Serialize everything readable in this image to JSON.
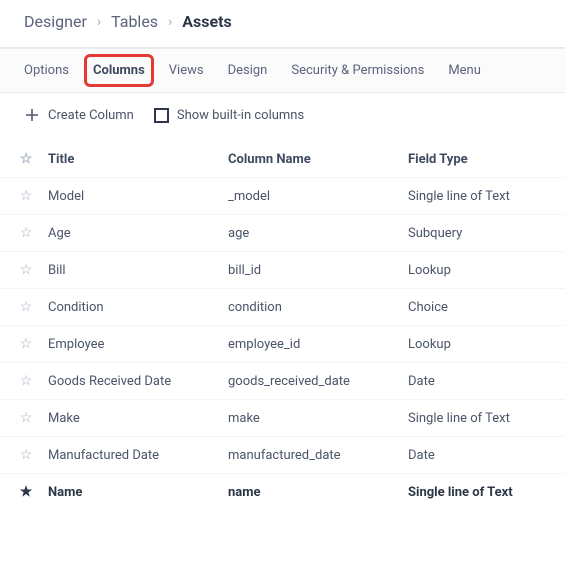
{
  "breadcrumb": {
    "items": [
      "Designer",
      "Tables",
      "Assets"
    ]
  },
  "tabs": {
    "items": [
      {
        "label": "Options",
        "active": false
      },
      {
        "label": "Columns",
        "active": true
      },
      {
        "label": "Views",
        "active": false
      },
      {
        "label": "Design",
        "active": false
      },
      {
        "label": "Security & Permissions",
        "active": false
      },
      {
        "label": "Menu",
        "active": false
      }
    ]
  },
  "toolbar": {
    "create_label": "Create Column",
    "builtin_label": "Show built-in columns"
  },
  "table": {
    "headers": {
      "title": "Title",
      "column_name": "Column Name",
      "field_type": "Field Type"
    },
    "rows": [
      {
        "title": "Model",
        "column_name": "_model",
        "field_type": "Single line of Text",
        "starred": false,
        "highlight": false
      },
      {
        "title": "Age",
        "column_name": "age",
        "field_type": "Subquery",
        "starred": false,
        "highlight": false
      },
      {
        "title": "Bill",
        "column_name": "bill_id",
        "field_type": "Lookup",
        "starred": false,
        "highlight": false
      },
      {
        "title": "Condition",
        "column_name": "condition",
        "field_type": "Choice",
        "starred": false,
        "highlight": false
      },
      {
        "title": "Employee",
        "column_name": "employee_id",
        "field_type": "Lookup",
        "starred": false,
        "highlight": false
      },
      {
        "title": "Goods Received Date",
        "column_name": "goods_received_date",
        "field_type": "Date",
        "starred": false,
        "highlight": false
      },
      {
        "title": "Make",
        "column_name": "make",
        "field_type": "Single line of Text",
        "starred": false,
        "highlight": false
      },
      {
        "title": "Manufactured Date",
        "column_name": "manufactured_date",
        "field_type": "Date",
        "starred": false,
        "highlight": false
      },
      {
        "title": "Name",
        "column_name": "name",
        "field_type": "Single line of Text",
        "starred": true,
        "highlight": true
      }
    ]
  },
  "icons": {
    "star_outline": "☆",
    "star_filled": "★"
  }
}
